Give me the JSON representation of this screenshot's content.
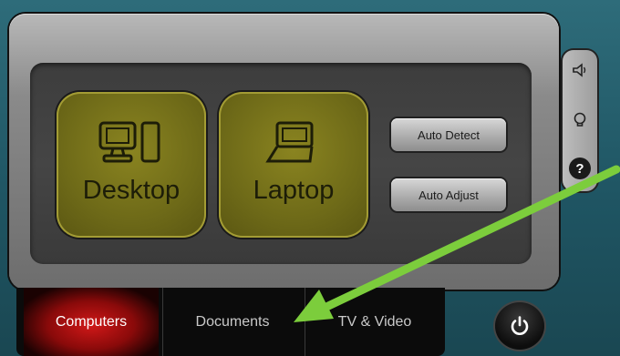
{
  "main": {
    "buttons": {
      "desktop_label": "Desktop",
      "laptop_label": "Laptop",
      "auto_detect_label": "Auto Detect",
      "auto_adjust_label": "Auto Adjust"
    }
  },
  "side_panel": {
    "icons": [
      "speaker-icon",
      "lightbulb-icon",
      "help-icon"
    ]
  },
  "tabs": [
    {
      "label": "Computers",
      "active": true
    },
    {
      "label": "Documents",
      "active": false
    },
    {
      "label": "TV & Video",
      "active": false
    }
  ],
  "power": {
    "icon": "power-icon"
  },
  "annotation": {
    "color": "#7ccd3c"
  },
  "colors": {
    "active_tab": "#d01818",
    "tile": "#6e6a18"
  }
}
